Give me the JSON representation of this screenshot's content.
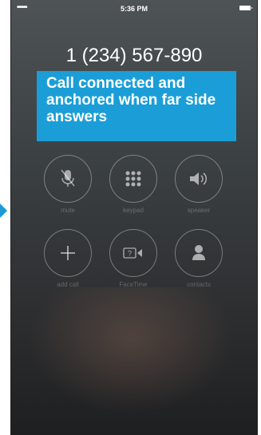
{
  "status_bar": {
    "signal": "•••••",
    "time": "5:36 PM"
  },
  "call": {
    "number": "1 (234) 567-890"
  },
  "callout": {
    "text": "Call connected and anchored when far side answers"
  },
  "buttons": [
    {
      "label": "mute",
      "icon": "microphone-muted-icon"
    },
    {
      "label": "keypad",
      "icon": "keypad-icon"
    },
    {
      "label": "speaker",
      "icon": "speaker-icon"
    },
    {
      "label": "add call",
      "icon": "plus-icon"
    },
    {
      "label": "FaceTime",
      "icon": "facetime-icon"
    },
    {
      "label": "contacts",
      "icon": "contact-icon"
    }
  ],
  "colors": {
    "accent": "#1b9ed7",
    "background": "#3c4144"
  }
}
